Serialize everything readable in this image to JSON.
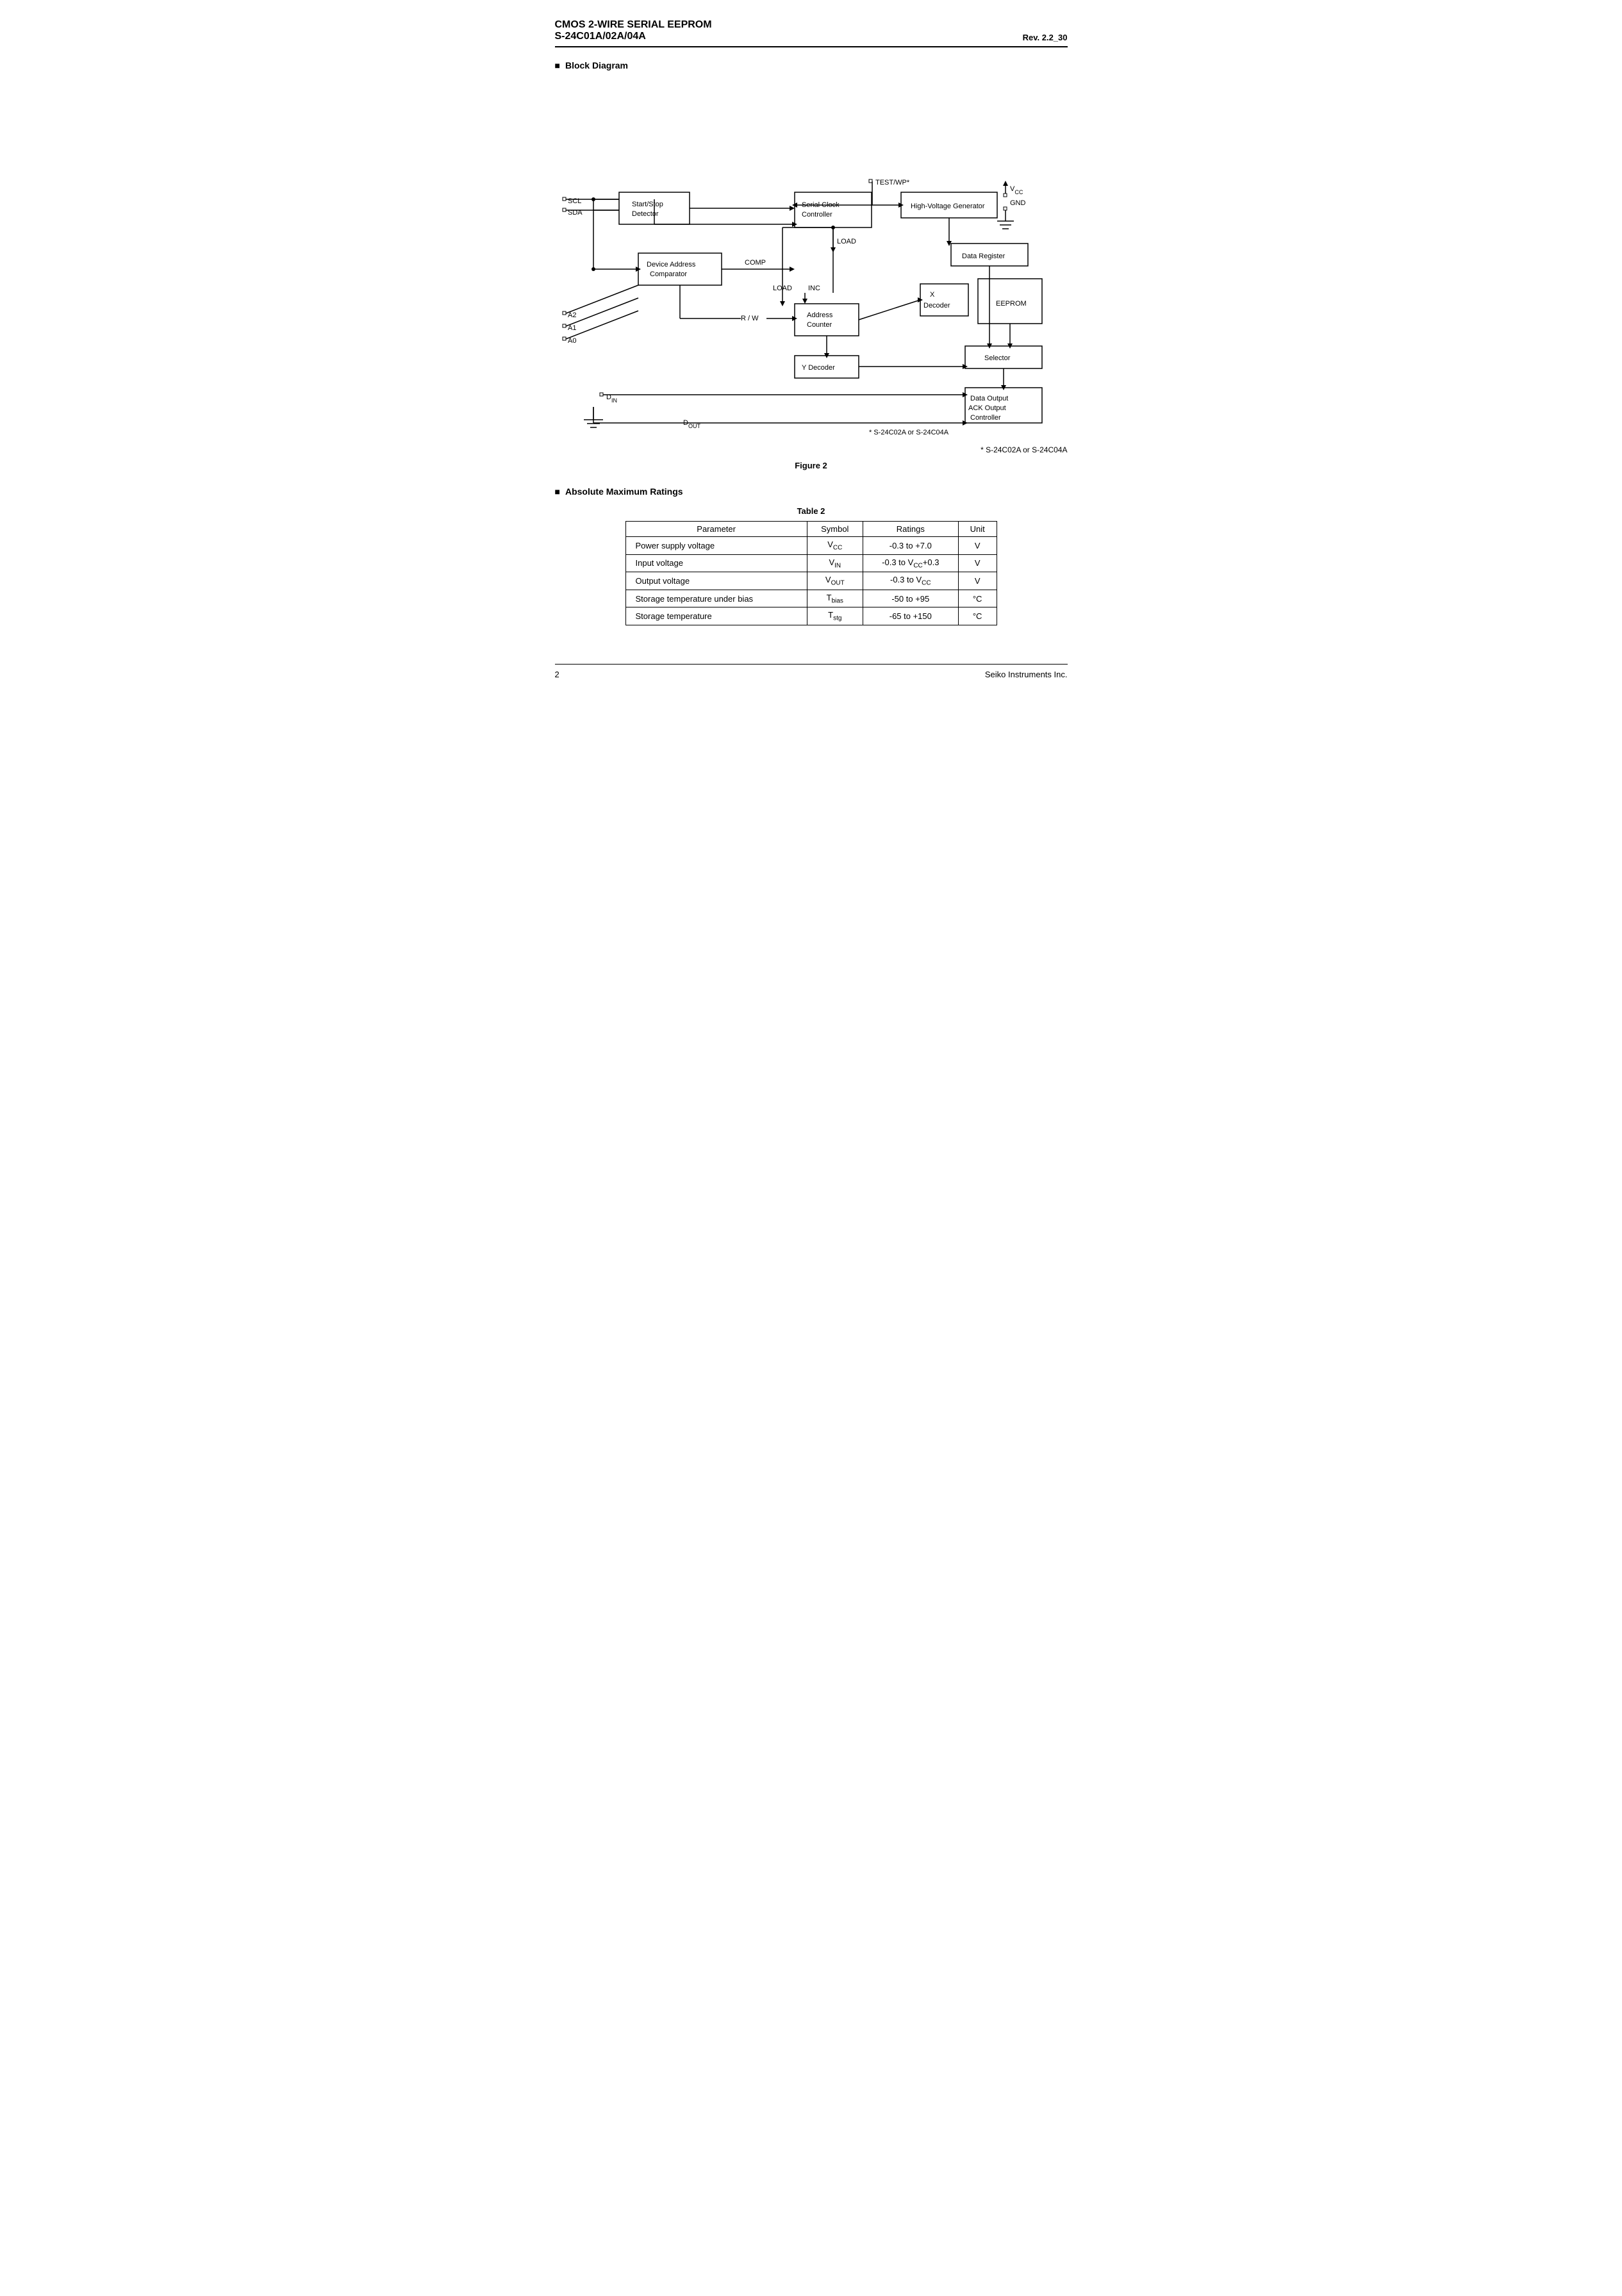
{
  "header": {
    "title1": "CMOS 2-WIRE SERIAL  EEPROM",
    "title2": "S-24C01A/02A/04A",
    "revision": "Rev. 2.2_30"
  },
  "sections": {
    "block_diagram": {
      "label": "Block Diagram",
      "figure_caption": "Figure 2",
      "note": "* S-24C02A or S-24C04A"
    },
    "abs_max": {
      "label": "Absolute Maximum Ratings",
      "table_caption": "Table  2",
      "columns": [
        "Parameter",
        "Symbol",
        "Ratings",
        "Unit"
      ],
      "rows": [
        [
          "Power supply voltage",
          "V_CC",
          "-0.3 to +7.0",
          "V"
        ],
        [
          "Input voltage",
          "V_IN",
          "-0.3 to V_CC+0.3",
          "V"
        ],
        [
          "Output voltage",
          "V_OUT",
          "-0.3 to V_CC",
          "V"
        ],
        [
          "Storage temperature under bias",
          "T_bias",
          "-50 to +95",
          "°C"
        ],
        [
          "Storage temperature",
          "T_stg",
          "-65 to +150",
          "°C"
        ]
      ]
    }
  },
  "footer": {
    "page": "2",
    "company": "Seiko Instruments Inc."
  }
}
